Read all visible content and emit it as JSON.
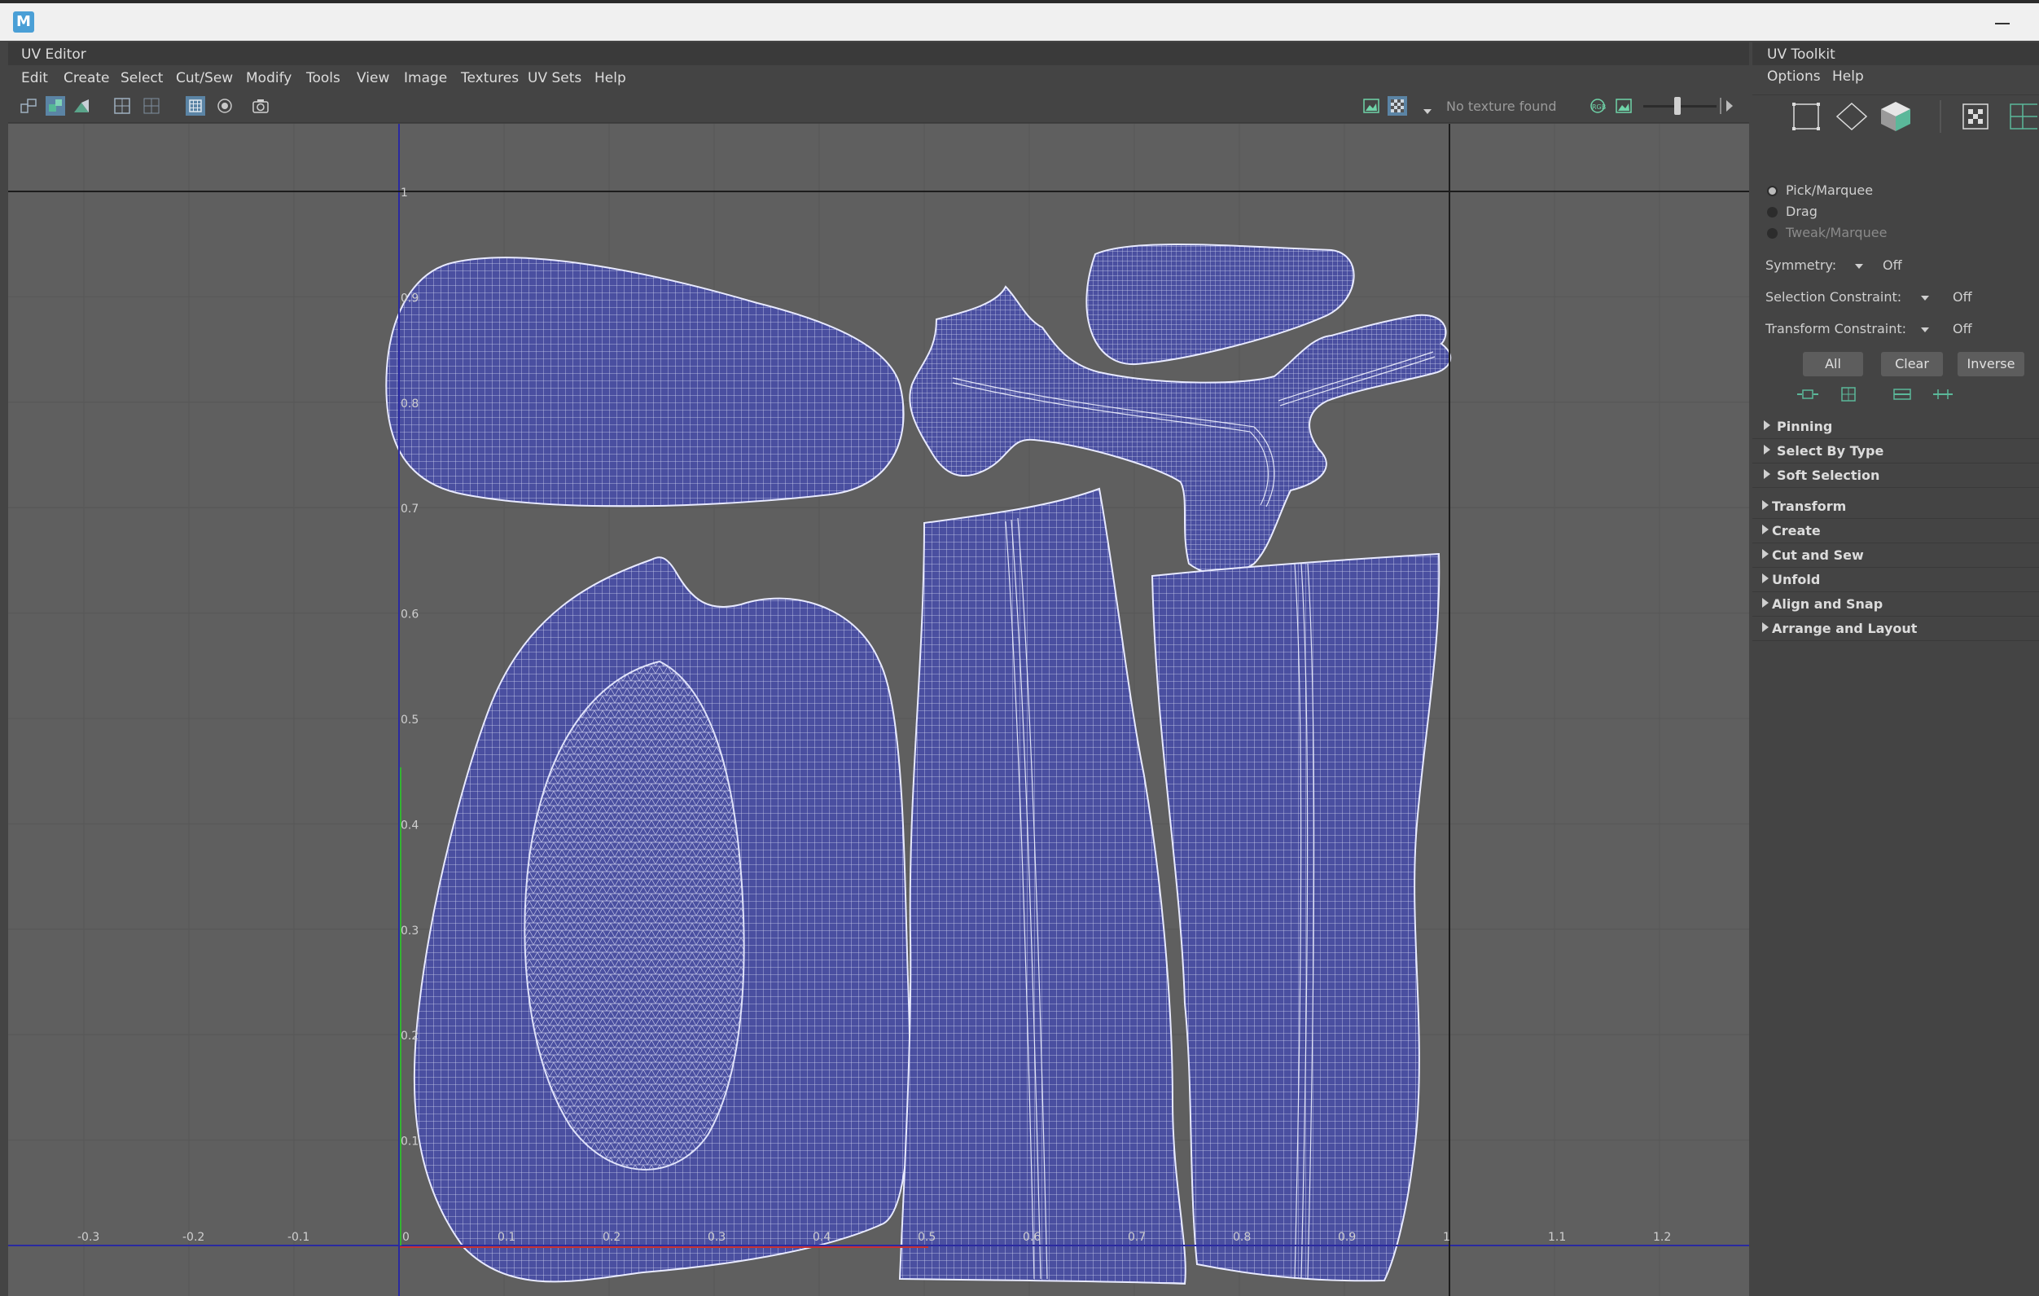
{
  "app": {
    "logo_letter": "M"
  },
  "uv_editor": {
    "title": "UV Editor",
    "menu": [
      "Edit",
      "Create",
      "Select",
      "Cut/Sew",
      "Modify",
      "Tools",
      "View",
      "Image",
      "Textures",
      "UV Sets",
      "Help"
    ],
    "toolbar_icons": [
      "uv-shell-icon",
      "uv-shaded-icon",
      "distortion-icon",
      "grid-icon",
      "subgrid-icon",
      "checker-icon",
      "snapshot-icon"
    ],
    "texture_status": "No texture found",
    "right_icons": [
      "image-display-icon",
      "checker-toggle-icon",
      "texture-filter-icon",
      "exposure-icon"
    ],
    "axis_x_labels": [
      "-0.3",
      "-0.2",
      "-0.1",
      "0",
      "0.1",
      "0.2",
      "0.3",
      "0.4",
      "0.5",
      "0.6",
      "0.7",
      "0.8",
      "0.9",
      "1",
      "1.1",
      "1.2"
    ],
    "axis_y_labels": [
      "1",
      "0.9",
      "0.8",
      "0.7",
      "0.6",
      "0.5",
      "0.4",
      "0.3",
      "0.2",
      "0.1"
    ],
    "shell_color": "#4a4fa0",
    "wire_color": "#e8eaff"
  },
  "uv_toolkit": {
    "title": "UV Toolkit",
    "menu": [
      "Options",
      "Help"
    ],
    "mode_icons": [
      "component-mode-icon",
      "vertex-diamond-icon",
      "object-cube-icon",
      "checker-select-icon",
      "grid-select-icon"
    ],
    "tools": [
      {
        "label": "Pick/Marquee",
        "selected": true,
        "enabled": true
      },
      {
        "label": "Drag",
        "selected": false,
        "enabled": true
      },
      {
        "label": "Tweak/Marquee",
        "selected": false,
        "enabled": false
      }
    ],
    "symmetry": {
      "label": "Symmetry:",
      "value": "Off"
    },
    "selection_constraint": {
      "label": "Selection Constraint:",
      "value": "Off"
    },
    "transform_constraint": {
      "label": "Transform Constraint:",
      "value": "Off"
    },
    "buttons": {
      "all": "All",
      "clear": "Clear",
      "inverse": "Inverse"
    },
    "sub_sections": [
      "Pinning",
      "Select By Type",
      "Soft Selection"
    ],
    "sections": [
      "Transform",
      "Create",
      "Cut and Sew",
      "Unfold",
      "Align and Snap",
      "Arrange and Layout"
    ]
  }
}
